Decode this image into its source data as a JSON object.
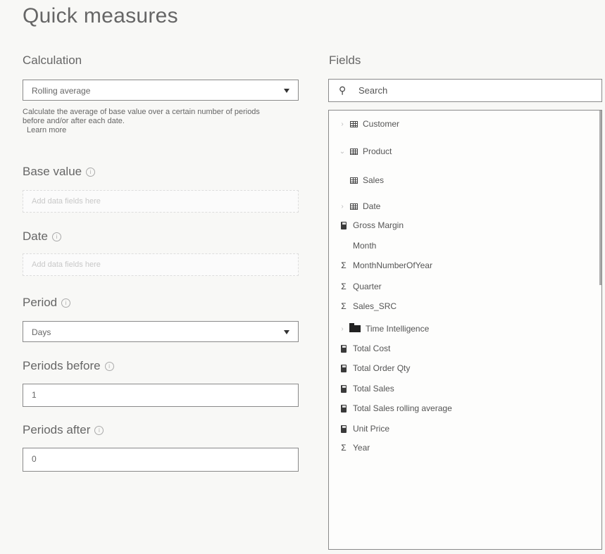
{
  "title": "Quick measures",
  "calculation": {
    "label": "Calculation",
    "selected": "Rolling average",
    "description": "Calculate the average of base value over a certain number of periods before and/or after each date.",
    "learn_more": "Learn more"
  },
  "base_value": {
    "label": "Base value",
    "placeholder": "Add data fields here"
  },
  "date": {
    "label": "Date",
    "placeholder": "Add data fields here"
  },
  "period": {
    "label": "Period",
    "selected": "Days"
  },
  "periods_before": {
    "label": "Periods before",
    "value": "1"
  },
  "periods_after": {
    "label": "Periods after",
    "value": "0"
  },
  "fields": {
    "label": "Fields",
    "search_placeholder": "Search",
    "items": [
      {
        "label": "Customer",
        "icon": "table-icon",
        "expander": "chevron-right"
      },
      {
        "label": "Product",
        "icon": "table-icon",
        "expander": "chevron-down"
      },
      {
        "label": "Sales",
        "icon": "table-icon",
        "expander": "none"
      },
      {
        "label": "Date",
        "icon": "table-icon",
        "expander": "chevron-right"
      },
      {
        "label": "Gross Margin",
        "icon": "calculator-icon",
        "expander": "none"
      },
      {
        "label": "Month",
        "icon": "none",
        "expander": "none"
      },
      {
        "label": "MonthNumberOfYear",
        "icon": "sigma-icon",
        "expander": "none"
      },
      {
        "label": "Quarter",
        "icon": "sigma-icon",
        "expander": "none"
      },
      {
        "label": "Sales_SRC",
        "icon": "sigma-icon",
        "expander": "none"
      },
      {
        "label": "Time Intelligence",
        "icon": "folder-icon",
        "expander": "chevron-right"
      },
      {
        "label": "Total Cost",
        "icon": "calculator-icon",
        "expander": "none"
      },
      {
        "label": "Total Order Qty",
        "icon": "calculator-icon",
        "expander": "none"
      },
      {
        "label": "Total Sales",
        "icon": "calculator-icon",
        "expander": "none"
      },
      {
        "label": "Total Sales rolling average",
        "icon": "calculator-icon",
        "expander": "none"
      },
      {
        "label": "Unit Price",
        "icon": "calculator-icon",
        "expander": "none"
      },
      {
        "label": "Year",
        "icon": "sigma-icon",
        "expander": "none"
      }
    ]
  }
}
